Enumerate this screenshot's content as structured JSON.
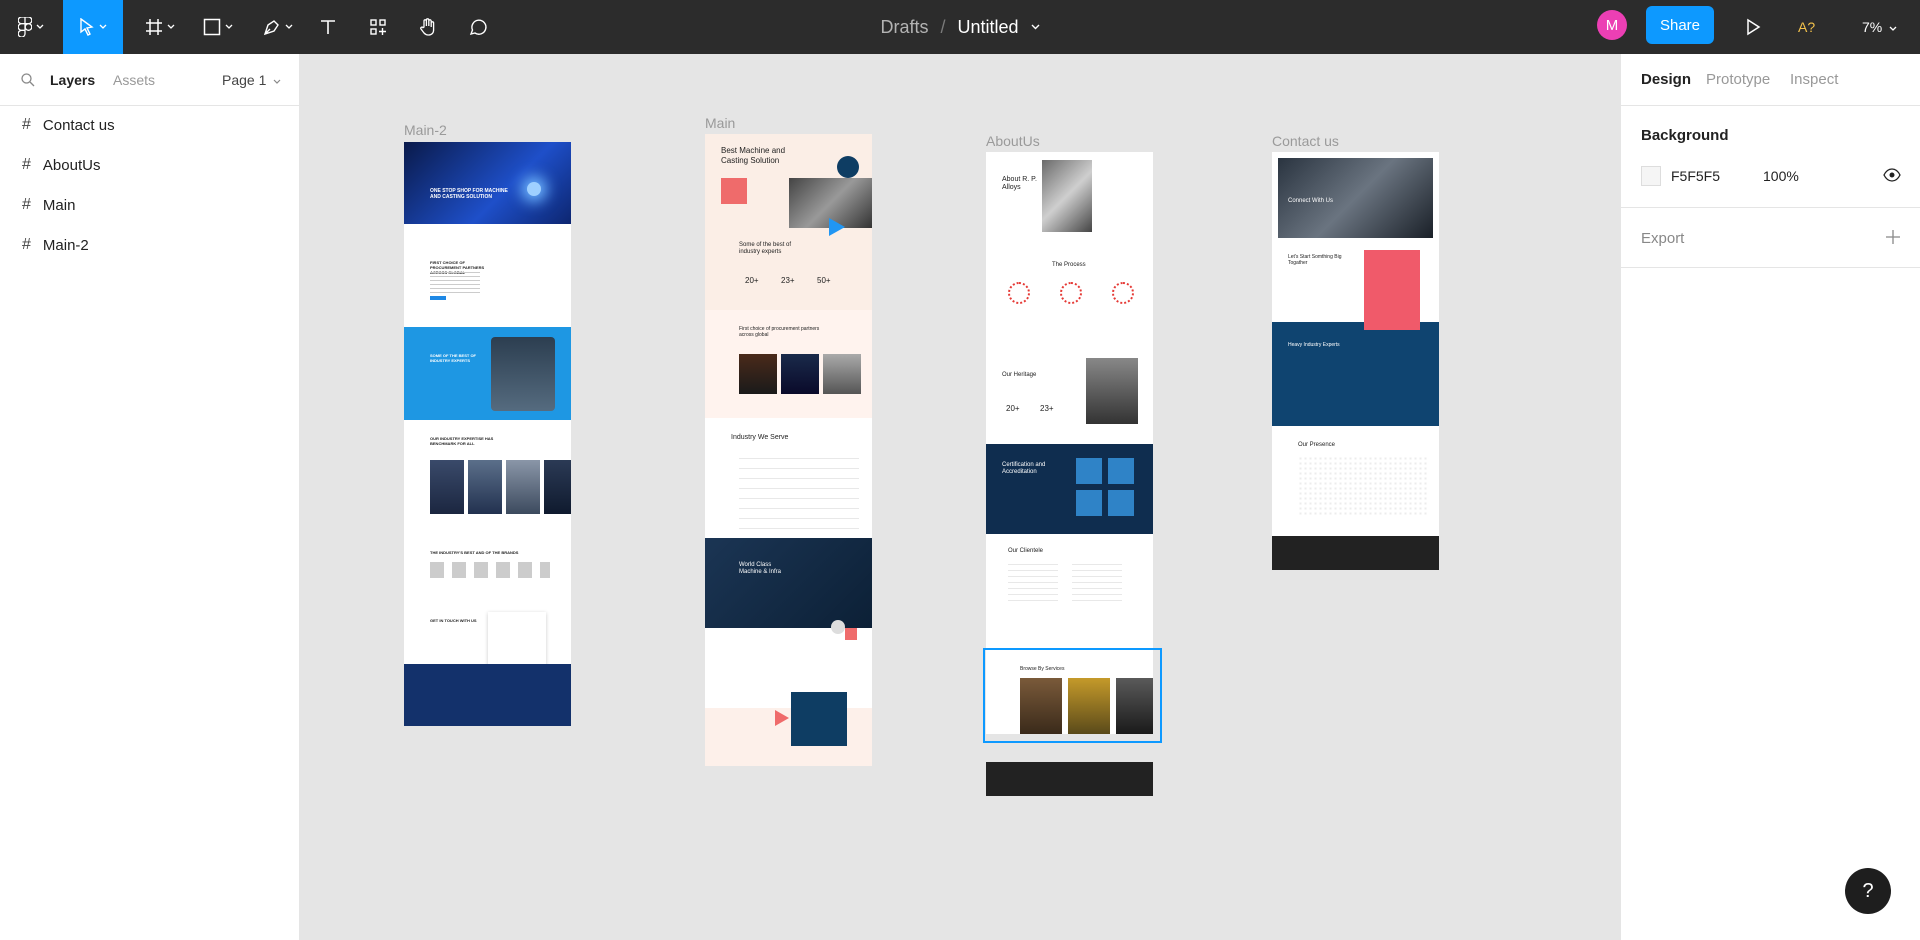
{
  "toolbar": {
    "breadcrumb": "Drafts",
    "separator": "/",
    "doc_name": "Untitled",
    "avatar_initial": "M",
    "share_label": "Share",
    "font_missing_label": "A?",
    "zoom": "7%"
  },
  "left_panel": {
    "tabs": [
      "Layers",
      "Assets"
    ],
    "page": "Page 1",
    "layers": [
      "Contact us",
      "AboutUs",
      "Main",
      "Main-2"
    ]
  },
  "canvas": {
    "frames": [
      {
        "label": "Main-2"
      },
      {
        "label": "Main"
      },
      {
        "label": "AboutUs"
      },
      {
        "label": "Contact us"
      }
    ],
    "texts": {
      "m2_hero": "ONE STOP SHOP FOR MACHINE AND CASTING SOLUTION",
      "m2_s2": "FIRST CHOICE OF PROCUREMENT PARTNERS ACROSS GLOBAL",
      "m2_s3": "SOME OF THE BEST OF INDUSTRY EXPERTS",
      "m2_s4": "OUR INDUSTRY EXPERTISE HAS BENCHMARK FOR ALL",
      "m2_s5": "THE INDUSTRY'S BEST AND OF THE BRANDS",
      "m2_s6": "GET IN TOUCH WITH US",
      "main_hero": "Best Machine and Casting Solution",
      "main_s2": "Some of the best of industry experts",
      "main_stats": [
        "20+",
        "23+",
        "50+"
      ],
      "main_s3": "First choice of procurement partners across global",
      "main_s4": "Industry We Serve",
      "main_s5": "World Class Machine & Infra",
      "about_hero": "About R. P. Alloys",
      "about_s2": "The Process",
      "about_s3": "Our Heritage",
      "about_stats": [
        "20+",
        "23+"
      ],
      "about_s4": "Certification and Accreditation",
      "about_s5": "Our Clientele",
      "about_s6": "Browse By Services",
      "contact_hero": "Connect With Us",
      "contact_s2": "Let's Start Somthing Big Togather",
      "contact_s3": "Heavy Industry Experts",
      "contact_s4": "Our Presence"
    }
  },
  "right_panel": {
    "tabs": [
      "Design",
      "Prototype",
      "Inspect"
    ],
    "background_title": "Background",
    "bg_hex": "F5F5F5",
    "bg_opacity": "100%",
    "export_title": "Export"
  },
  "help_label": "?",
  "colors": {
    "accent": "#0d99ff",
    "toolbar": "#2c2c2c",
    "avatar": "#ec3fb4",
    "warning": "#f2c14b"
  }
}
